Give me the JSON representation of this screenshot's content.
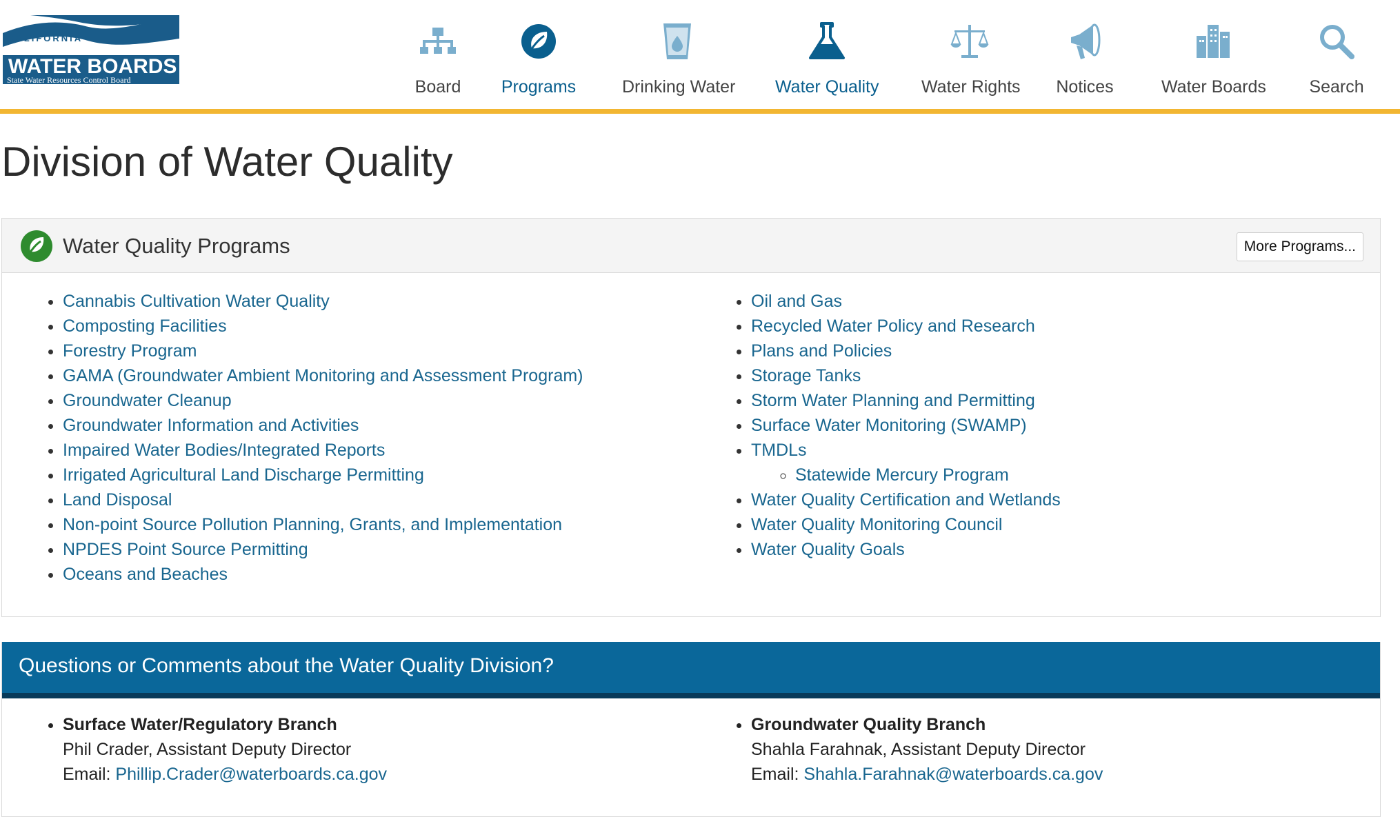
{
  "logo": {
    "top_text": "CALIFORNIA",
    "main_text": "WATER BOARDS",
    "sub_text": "State Water Resources Control Board"
  },
  "nav": [
    {
      "label": "Board",
      "icon": "org-chart-icon"
    },
    {
      "label": "Programs",
      "icon": "leaf-icon",
      "active": true
    },
    {
      "label": "Drinking Water",
      "icon": "water-glass-icon"
    },
    {
      "label": "Water Quality",
      "icon": "flask-icon",
      "active": true
    },
    {
      "label": "Water Rights",
      "icon": "scales-icon"
    },
    {
      "label": "Notices",
      "icon": "megaphone-icon"
    },
    {
      "label": "Water Boards",
      "icon": "buildings-icon"
    },
    {
      "label": "Search",
      "icon": "search-icon"
    }
  ],
  "colors": {
    "accent_bar": "#f2b632",
    "link": "#19668f",
    "nav_active": "#0a5f8e",
    "contact_header": "#0a679a"
  },
  "page_title": "Division of Water Quality",
  "programs": {
    "title": "Water Quality Programs",
    "more_button": "More Programs...",
    "left": [
      "Cannabis Cultivation Water Quality",
      "Composting Facilities",
      "Forestry Program",
      "GAMA (Groundwater Ambient Monitoring and Assessment Program)",
      "Groundwater Cleanup",
      "Groundwater Information and Activities",
      "Impaired Water Bodies/Integrated Reports",
      "Irrigated Agricultural Land Discharge Permitting",
      "Land Disposal",
      "Non-point Source Pollution Planning, Grants, and Implementation",
      "NPDES Point Source Permitting",
      "Oceans and Beaches"
    ],
    "right": [
      "Oil and Gas",
      "Recycled Water Policy and Research",
      "Plans and Policies",
      "Storage Tanks",
      "Storm Water Planning and Permitting",
      "Surface Water Monitoring (SWAMP)",
      "TMDLs",
      "Water Quality Certification and Wetlands",
      "Water Quality Monitoring Council",
      "Water Quality Goals"
    ],
    "tmdl_sub": "Statewide Mercury Program"
  },
  "contact": {
    "title": "Questions or Comments about the Water Quality Division?",
    "left": {
      "branch": "Surface Water/Regulatory Branch",
      "person": "Phil Crader, Assistant Deputy Director",
      "email_label": "Email: ",
      "email": "Phillip.Crader@waterboards.ca.gov"
    },
    "right": {
      "branch": "Groundwater Quality Branch",
      "person": "Shahla Farahnak, Assistant Deputy Director",
      "email_label": "Email: ",
      "email": "Shahla.Farahnak@waterboards.ca.gov"
    }
  }
}
